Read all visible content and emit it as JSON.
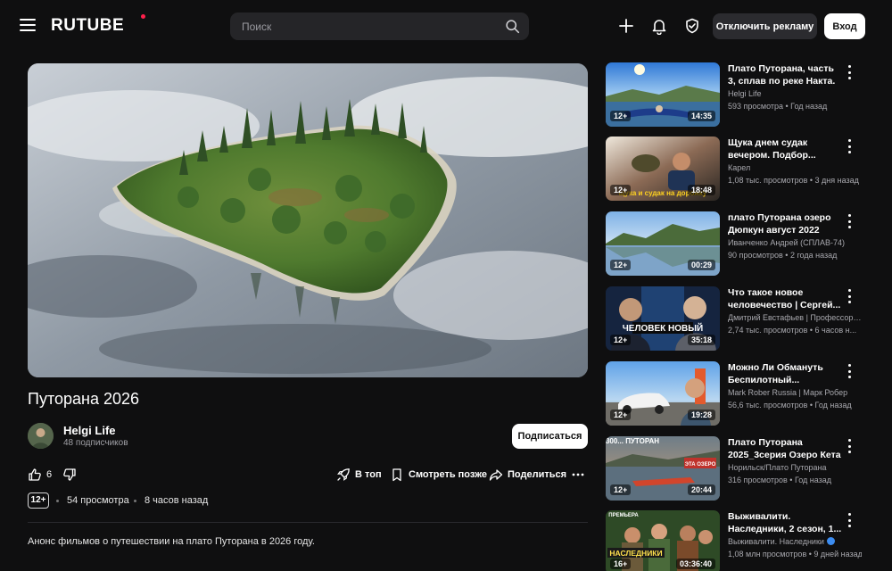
{
  "header": {
    "logo": "RUTUBE",
    "search_placeholder": "Поиск",
    "disable_ads_label": "Отключить рекламу",
    "login_label": "Вход"
  },
  "video": {
    "title": "Путорана 2026",
    "channel": "Helgi Life",
    "subscribers": "48 подписчиков",
    "subscribe_label": "Подписаться",
    "likes": "6",
    "top_label": "В топ",
    "watch_later_label": "Смотреть позже",
    "share_label": "Поделиться",
    "age_rating": "12+",
    "views": "54 просмотра",
    "published": "8 часов назад",
    "description": "Анонс фильмов о путешествии на плато Путорана в 2026 году."
  },
  "recommendations": [
    {
      "title": "Плато Путорана, часть 3, сплав по реке Накта.",
      "channel": "Helgi Life",
      "stats": "593 просмотра • Год назад",
      "age": "12+",
      "duration": "14:35",
      "verified": false
    },
    {
      "title": "Щука днем судак вечером. Подбор...",
      "channel": "Карел",
      "stats": "1,08 тыс. просмотров • 3 дня назад",
      "age": "12+",
      "duration": "18:48",
      "verified": false
    },
    {
      "title": "плато Путорана озеро Дюпкун август 2022",
      "channel": "Иванченко Андрей (СПЛАВ-74)",
      "stats": "90 просмотров • 2 года назад",
      "age": "12+",
      "duration": "00:29",
      "verified": false
    },
    {
      "title": "Что такое новое человечество | Сергей...",
      "channel": "Дмитрий Евстафьев | Профессор с...",
      "stats": "2,74 тыс. просмотров • 6 часов н...",
      "age": "12+",
      "duration": "35:18",
      "verified": false
    },
    {
      "title": "Можно Ли Обмануть Беспилотный...",
      "channel": "Mark Rober Russia | Марк Робер",
      "stats": "56,6 тыс. просмотров • Год назад",
      "age": "12+",
      "duration": "19:28",
      "verified": false
    },
    {
      "title": "Плато Путорана 2025_3серия Озеро Кета",
      "channel": "Норильск/Плато Путорана",
      "stats": "316 просмотров • Год назад",
      "age": "12+",
      "duration": "20:44",
      "verified": false
    },
    {
      "title": "Выживалити. Наследники, 2 сезон, 1...",
      "channel": "Выживалити. Наследники",
      "stats": "1,08 млн просмотров • 9 дней назад",
      "age": "16+",
      "duration": "03:36:40",
      "verified": true
    }
  ],
  "thumb_captions": {
    "card1": "щука и судак на дорожку",
    "card3": "ЧЕЛОВЕК НОВЫЙ",
    "card5_top": "300... ПУТОРАН",
    "card5_tag": "ЭТА ОЗЕРО",
    "card6_top": "ПРЕМЬЕРА",
    "card6_main": "НАСЛЕДНИКИ"
  }
}
